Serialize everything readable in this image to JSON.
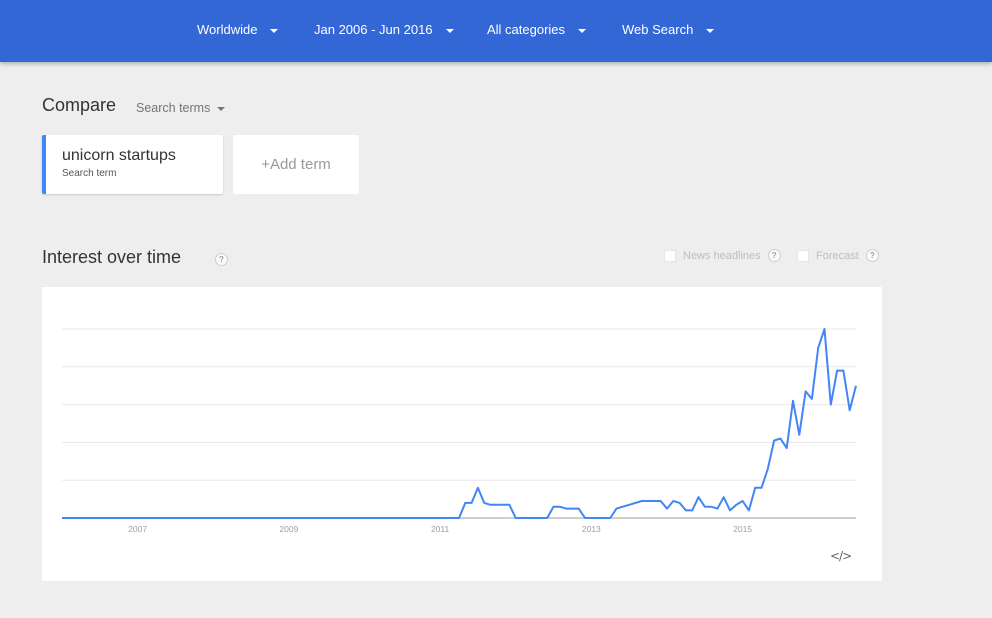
{
  "header": {
    "filters": [
      {
        "label": "Worldwide",
        "icon": "caret-down-icon"
      },
      {
        "label": "Jan 2006 - Jun 2016",
        "icon": "caret-down-icon"
      },
      {
        "label": "All categories",
        "icon": "caret-down-icon"
      },
      {
        "label": "Web Search",
        "icon": "caret-down-icon"
      }
    ]
  },
  "compare": {
    "title": "Compare",
    "mode_label": "Search terms",
    "terms": [
      {
        "name": "unicorn startups",
        "type": "Search term",
        "color": "#4285f4"
      }
    ],
    "add_term_label": "+Add term"
  },
  "interest": {
    "title": "Interest over time",
    "help_glyph": "?",
    "news_headlines_label": "News headlines",
    "forecast_label": "Forecast",
    "embed_glyph": "</>"
  },
  "chart_data": {
    "type": "line",
    "title": "Interest over time",
    "xlabel": "",
    "ylabel": "",
    "x_start": "2006-01",
    "x_end": "2016-06",
    "x_tick_labels": [
      "2007",
      "2009",
      "2011",
      "2013",
      "2015"
    ],
    "x_tick_month_index": [
      12,
      36,
      60,
      84,
      108
    ],
    "ylim": [
      0,
      100
    ],
    "y_gridlines": [
      20,
      40,
      60,
      80,
      100
    ],
    "grid": true,
    "legend": "none",
    "series": [
      {
        "name": "unicorn startups",
        "color": "#4285f4",
        "values": [
          0,
          0,
          0,
          0,
          0,
          0,
          0,
          0,
          0,
          0,
          0,
          0,
          0,
          0,
          0,
          0,
          0,
          0,
          0,
          0,
          0,
          0,
          0,
          0,
          0,
          0,
          0,
          0,
          0,
          0,
          0,
          0,
          0,
          0,
          0,
          0,
          0,
          0,
          0,
          0,
          0,
          0,
          0,
          0,
          0,
          0,
          0,
          0,
          0,
          0,
          0,
          0,
          0,
          0,
          0,
          0,
          0,
          0,
          0,
          0,
          0,
          0,
          0,
          0,
          8,
          8,
          16,
          8,
          7,
          7,
          7,
          7,
          0,
          0,
          0,
          0,
          0,
          0,
          6,
          6,
          5,
          5,
          5,
          0,
          0,
          0,
          0,
          0,
          5,
          6,
          7,
          8,
          9,
          9,
          9,
          9,
          5,
          9,
          8,
          4,
          4,
          11,
          6,
          6,
          5,
          11,
          4,
          7,
          9,
          4,
          16,
          16,
          26,
          41,
          42,
          37,
          62,
          44,
          67,
          63,
          90,
          100,
          60,
          78,
          78,
          57,
          70
        ]
      }
    ]
  }
}
